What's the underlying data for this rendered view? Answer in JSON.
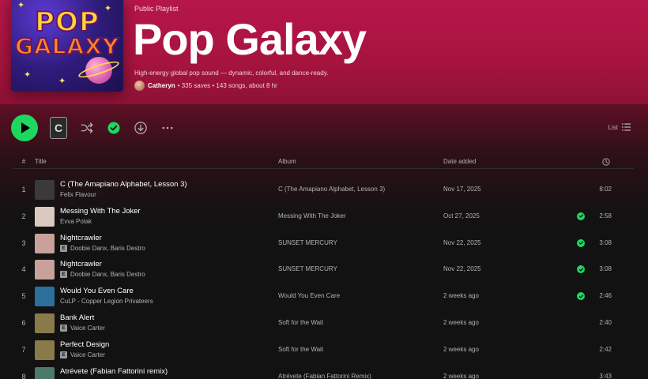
{
  "header": {
    "playlist_type": "Public Playlist",
    "title": "Pop Galaxy",
    "description": "High-energy global pop sound — dynamic, colorful, and dance-ready.",
    "owner": "Catheryn",
    "stats": "• 335 saves • 143 songs, about 8 hr",
    "cover_word_1": "POP",
    "cover_word_2": "GALAXY"
  },
  "actions": {
    "mini_cover_letter": "C",
    "view_label": "List",
    "accent": "#1ed760"
  },
  "columns": {
    "num": "#",
    "title": "Title",
    "album": "Album",
    "date": "Date added"
  },
  "tracks": [
    {
      "num": "1",
      "title": "C (The Amapiano Alphabet, Lesson 3)",
      "artist": "Felix Flavour",
      "explicit": false,
      "album": "C (The Amapiano Alphabet, Lesson 3)",
      "date": "Nov 17, 2025",
      "saved": false,
      "duration": "8:02",
      "art": "#3a3a3a"
    },
    {
      "num": "2",
      "title": "Messing With The Joker",
      "artist": "Evva Polak",
      "explicit": false,
      "album": "Messing With The Joker",
      "date": "Oct 27, 2025",
      "saved": true,
      "duration": "2:58",
      "art": "#d9c9bf"
    },
    {
      "num": "3",
      "title": "Nightcrawler",
      "artist": "Doobie Danx, Baris Destro",
      "explicit": true,
      "album": "SUNSET MERCURY",
      "date": "Nov 22, 2025",
      "saved": true,
      "duration": "3:08",
      "art": "#c8a19a"
    },
    {
      "num": "4",
      "title": "Nightcrawler",
      "artist": "Doobie Danx, Baris Destro",
      "explicit": true,
      "album": "SUNSET MERCURY",
      "date": "Nov 22, 2025",
      "saved": true,
      "duration": "3:08",
      "art": "#c8a19a"
    },
    {
      "num": "5",
      "title": "Would You Even Care",
      "artist": "CuLP - Copper Legion Privateers",
      "explicit": false,
      "album": "Would You Even Care",
      "date": "2 weeks ago",
      "saved": true,
      "duration": "2:46",
      "art": "#2b6f9a"
    },
    {
      "num": "6",
      "title": "Bank Alert",
      "artist": "Vaice Carter",
      "explicit": true,
      "album": "Soft for the Wait",
      "date": "2 weeks ago",
      "saved": false,
      "duration": "2:40",
      "art": "#8a7a4a"
    },
    {
      "num": "7",
      "title": "Perfect Design",
      "artist": "Vaice Carter",
      "explicit": true,
      "album": "Soft for the Wait",
      "date": "2 weeks ago",
      "saved": false,
      "duration": "2:42",
      "art": "#8a7a4a"
    },
    {
      "num": "8",
      "title": "Atrévete (Fabian Fattorini remix)",
      "artist": "",
      "explicit": false,
      "album": "Atrévete (Fabian Fattorini Remix)",
      "date": "2 weeks ago",
      "saved": false,
      "duration": "3:43",
      "art": "#4b7a6a"
    }
  ]
}
